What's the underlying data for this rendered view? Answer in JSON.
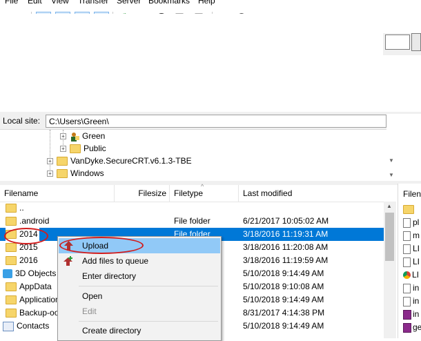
{
  "menubar": {
    "items": [
      "File",
      "Edit",
      "View",
      "Transfer",
      "Server",
      "Bookmarks",
      "Help"
    ]
  },
  "toolbar": {
    "icons": [
      "site-manager-icon",
      "dropdown-arrow-icon",
      "toggle-log-icon",
      "toggle-local-tree-icon",
      "toggle-remote-tree-icon",
      "toggle-queue-icon",
      "refresh-icon",
      "process-queue-icon",
      "cancel-icon",
      "disconnect-icon",
      "reconnect-icon",
      "directory-filter-icon",
      "compare-icon",
      "sync-browse-icon",
      "search-icon"
    ]
  },
  "local_site": {
    "label": "Local site:",
    "path": "C:\\Users\\Green\\"
  },
  "tree": {
    "items": [
      {
        "label": "Green",
        "icon": "user-folder-icon"
      },
      {
        "label": "Public",
        "icon": "folder-icon"
      },
      {
        "label": "VanDyke.SecureCRT.v6.1.3-TBE",
        "icon": "folder-icon"
      },
      {
        "label": "Windows",
        "icon": "folder-icon"
      }
    ]
  },
  "file_list": {
    "headers": {
      "filename": "Filename",
      "filesize": "Filesize",
      "filetype": "Filetype",
      "modified": "Last modified"
    },
    "rows": [
      {
        "name": "..",
        "type": "",
        "modified": ""
      },
      {
        "name": ".android",
        "type": "File folder",
        "modified": "6/21/2017 10:05:02 AM"
      },
      {
        "name": "2014",
        "type": "File folder",
        "modified": "3/18/2016 11:19:31 AM"
      },
      {
        "name": "2015",
        "type": "",
        "modified": "3/18/2016 11:20:08 AM"
      },
      {
        "name": "2016",
        "type": "",
        "modified": "3/18/2016 11:19:59 AM"
      },
      {
        "name": "3D Objects",
        "type": "",
        "modified": "5/10/2018 9:14:49 AM"
      },
      {
        "name": "AppData",
        "type": "",
        "modified": "5/10/2018 9:10:08 AM"
      },
      {
        "name": "Application",
        "type": "",
        "modified": "5/10/2018 9:14:49 AM"
      },
      {
        "name": "Backup-oo",
        "type": "",
        "modified": "8/31/2017 4:14:38 PM"
      },
      {
        "name": "Contacts",
        "type": "",
        "modified": "5/10/2018 9:14:49 AM"
      }
    ]
  },
  "context_menu": {
    "items": [
      {
        "label": "Upload",
        "highlighted": true
      },
      {
        "label": "Add files to queue"
      },
      {
        "label": "Enter directory"
      },
      {
        "label": "Open"
      },
      {
        "label": "Edit",
        "disabled": true
      },
      {
        "label": "Create directory"
      }
    ]
  },
  "remote_panel": {
    "header": "Filen",
    "rows": [
      "pl",
      "m",
      "LI",
      "LI",
      "LI",
      "in",
      "in",
      "in",
      "ge"
    ]
  },
  "colors": {
    "selection": "#0078d7",
    "menu_highlight": "#91c9f7",
    "annotation_red": "#d21c1c",
    "folder_yellow": "#f6d56a"
  }
}
